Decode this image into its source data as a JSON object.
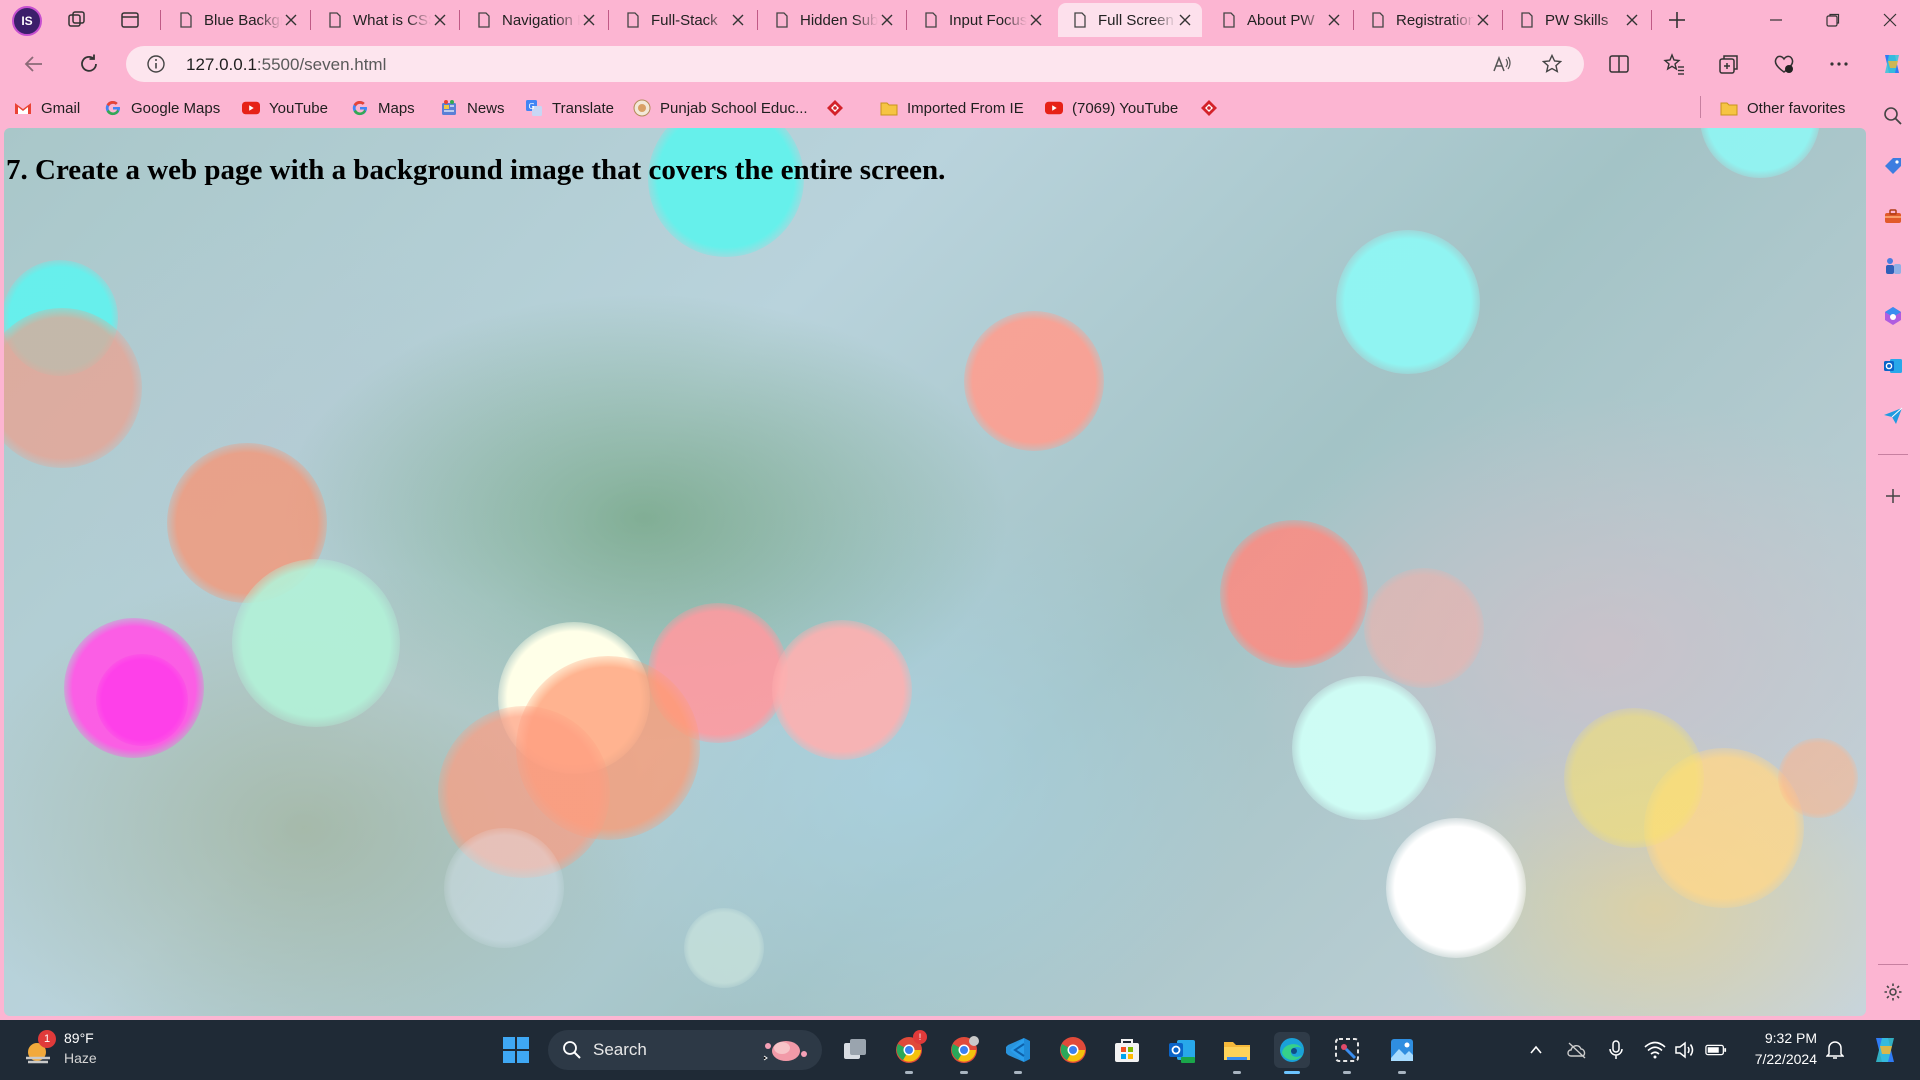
{
  "browser": {
    "profile_initials": "IS",
    "tabs": [
      {
        "title": "Blue Background",
        "active": false
      },
      {
        "title": "What is CSS",
        "active": false
      },
      {
        "title": "Navigation Bar",
        "active": false
      },
      {
        "title": "Full-Stack",
        "active": false
      },
      {
        "title": "Hidden Submenu",
        "active": false
      },
      {
        "title": "Input Focus",
        "active": false
      },
      {
        "title": "Full Screen",
        "active": true
      },
      {
        "title": "About PW",
        "active": false
      },
      {
        "title": "Registration",
        "active": false
      },
      {
        "title": "PW Skills",
        "active": false
      }
    ],
    "address": {
      "host": "127.0.0.1",
      "path": ":5500/seven.html"
    },
    "favorites": [
      {
        "label": "Gmail",
        "icon": "gmail-icon"
      },
      {
        "label": "Google Maps",
        "icon": "google-icon"
      },
      {
        "label": "YouTube",
        "icon": "youtube-icon"
      },
      {
        "label": "Maps",
        "icon": "google-icon"
      },
      {
        "label": "News",
        "icon": "news-icon"
      },
      {
        "label": "Translate",
        "icon": "translate-icon"
      },
      {
        "label": "Punjab School Educ...",
        "icon": "seal-icon"
      },
      {
        "label": "",
        "icon": "red-diamond-icon"
      },
      {
        "label": "Imported From IE",
        "icon": "folder-icon"
      },
      {
        "label": "(7069) YouTube",
        "icon": "youtube-icon"
      },
      {
        "label": "",
        "icon": "red-diamond-icon"
      }
    ],
    "other_favorites": "Other favorites"
  },
  "page": {
    "heading": "7. Create a web page with a background image that covers the entire screen."
  },
  "taskbar": {
    "weather": {
      "temp": "89°F",
      "condition": "Haze",
      "badge": "1"
    },
    "search_label": "Search",
    "time": "9:32 PM",
    "date": "7/22/2024"
  },
  "colors": {
    "chrome_pink": "#fcb5d2",
    "active_tab": "#fde0ec",
    "taskbar": "#1f2a36"
  }
}
